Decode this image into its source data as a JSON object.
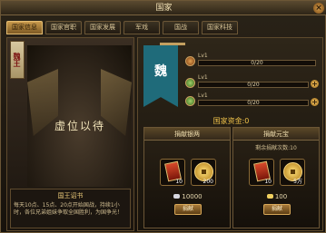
{
  "window": {
    "title": "国家",
    "close_symbol": "×"
  },
  "tabs": [
    {
      "label": "国家信息",
      "active": true
    },
    {
      "label": "国家官职",
      "active": false
    },
    {
      "label": "国家发展",
      "active": false
    },
    {
      "label": "军戏",
      "active": false
    },
    {
      "label": "国战",
      "active": false
    },
    {
      "label": "国家科技",
      "active": false
    }
  ],
  "left": {
    "king_tag": "魏王",
    "vacant_text": "虚位以待",
    "edict": {
      "title": "国王诏书",
      "body": "每天10点、15点、20点开始国战，持续1小时，各位兄弟姐妹争取全国胜利，为国争光！"
    }
  },
  "right": {
    "banner_text": "魏",
    "levels": [
      {
        "label": "Lv1",
        "text": "0/20",
        "progress": 0,
        "icon": "flag-icon"
      },
      {
        "label": "Lv1",
        "text": "0/20",
        "progress": 0,
        "icon": "sword-icon"
      },
      {
        "label": "Lv1",
        "text": "0/20",
        "progress": 0,
        "icon": "shield-icon"
      }
    ],
    "funds": "国家资金:0",
    "donate_silver": {
      "title": "捐献银两",
      "remain": "",
      "token_count": "10",
      "coin_count": "200",
      "cost": "10000",
      "button": "捐献"
    },
    "donate_yuanbao": {
      "title": "捐献元宝",
      "remain": "剩余捐献次数:10",
      "token_count": "10",
      "coin_count": "5万",
      "cost": "100",
      "button": "捐献"
    }
  },
  "colors": {
    "accent": "#c99a4c",
    "banner": "#1f6b7a",
    "funds": "#f0c24a"
  }
}
